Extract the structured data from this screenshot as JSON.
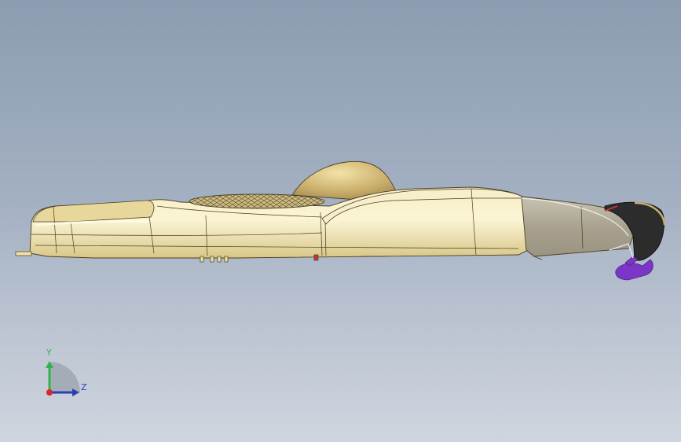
{
  "viewport": {
    "background_top": "#8c9cb1",
    "background_bottom": "#cfd5de",
    "model": "vehicle-body-side-view"
  },
  "model_colors": {
    "body": "#efe2a4",
    "body_shadow": "#c9b46e",
    "edge": "#4a3e22",
    "rear_section": "#b0a894",
    "bumper": "#2c2c2c",
    "bracket": "#7b35c7"
  },
  "triad": {
    "y_label": "Y",
    "z_label": "Z",
    "y_color": "#34b24a",
    "z_color": "#2a3fb6",
    "x_color": "#d8262b"
  }
}
